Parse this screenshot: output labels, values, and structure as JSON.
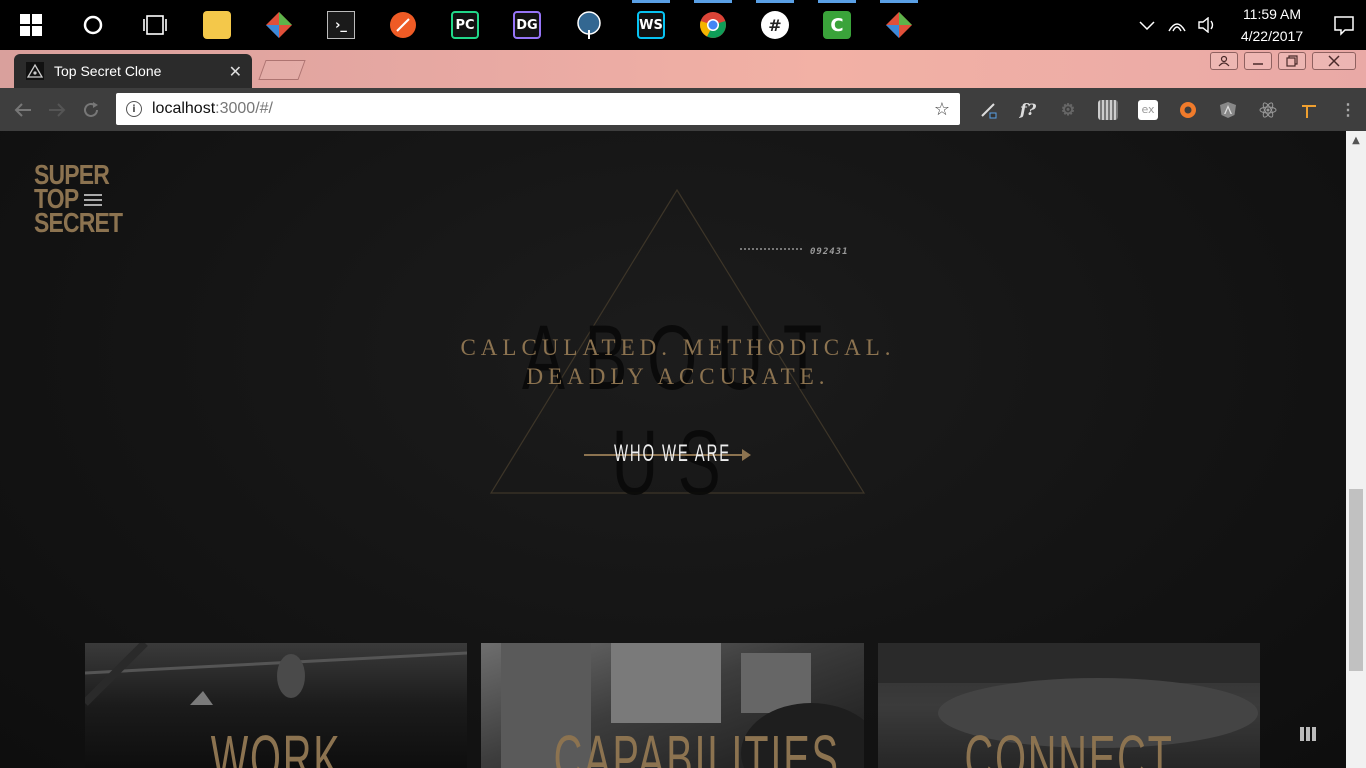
{
  "taskbar": {
    "apps": [
      {
        "name": "windows-start",
        "label": ""
      },
      {
        "name": "cortana",
        "label": ""
      },
      {
        "name": "task-view",
        "label": ""
      },
      {
        "name": "file-explorer",
        "label": ""
      },
      {
        "name": "gitkraken",
        "label": ""
      },
      {
        "name": "terminal",
        "label": ""
      },
      {
        "name": "postman",
        "label": ""
      },
      {
        "name": "pycharm",
        "label": "PC"
      },
      {
        "name": "datagrip",
        "label": "DG"
      },
      {
        "name": "postgresql",
        "label": ""
      },
      {
        "name": "webstorm",
        "label": "WS"
      },
      {
        "name": "chrome",
        "label": ""
      },
      {
        "name": "slack",
        "label": "#"
      },
      {
        "name": "camtasia",
        "label": "C"
      },
      {
        "name": "gitkraken-2",
        "label": ""
      }
    ],
    "clock": {
      "time": "11:59 AM",
      "date": "4/22/2017"
    }
  },
  "browser": {
    "tab_title": "Top Secret Clone",
    "url_host": "localhost",
    "url_path": ":3000/#/"
  },
  "page": {
    "logo_lines": [
      "SUPER",
      "TOP",
      "SECRET"
    ],
    "code_number": "092431",
    "background_word": "ABOUT US",
    "tagline_line1": "CALCULATED. METHODICAL.",
    "tagline_line2": "DEADLY ACCURATE.",
    "cta_label": "WHO WE ARE",
    "tiles": [
      "WORK",
      "CAPABILITIES",
      "CONNECT"
    ]
  },
  "colors": {
    "accent_gold": "#8c7350",
    "page_bg": "#141414"
  }
}
